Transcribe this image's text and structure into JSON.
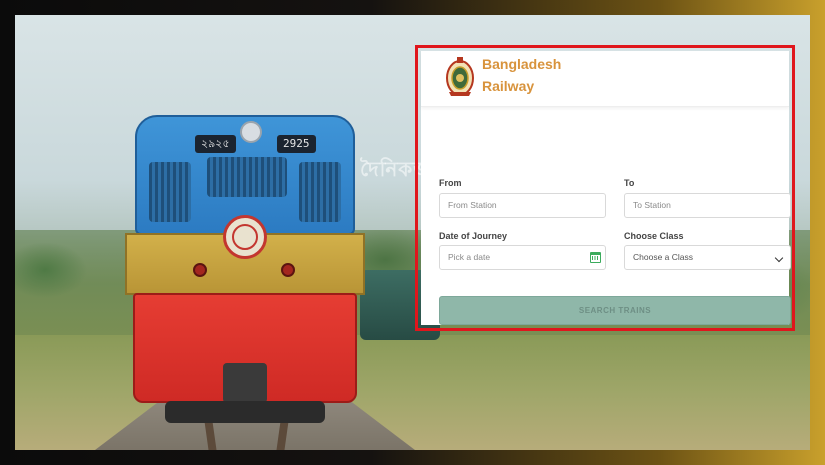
{
  "brand": {
    "line1": "Bangladesh",
    "line2": "Railway"
  },
  "loco": {
    "plate_left": "২৯২৫",
    "plate_right": "2925"
  },
  "watermark": {
    "text": "দৈনিকজনকণ্ঠ"
  },
  "form": {
    "from_label": "From",
    "from_placeholder": "From Station",
    "to_label": "To",
    "to_placeholder": "To Station",
    "date_label": "Date of Journey",
    "date_placeholder": "Pick a date",
    "class_label": "Choose Class",
    "class_value": "Choose a Class",
    "search_label": "SEARCH TRAINS"
  },
  "colors": {
    "brand": "#d8933c",
    "highlight": "#e0161c",
    "button": "#8fb7a9",
    "calendar_icon": "#3bab5c"
  },
  "icons": {
    "logo": "bangladesh-railway-emblem",
    "date": "calendar-icon",
    "select": "chevron-down-icon"
  }
}
